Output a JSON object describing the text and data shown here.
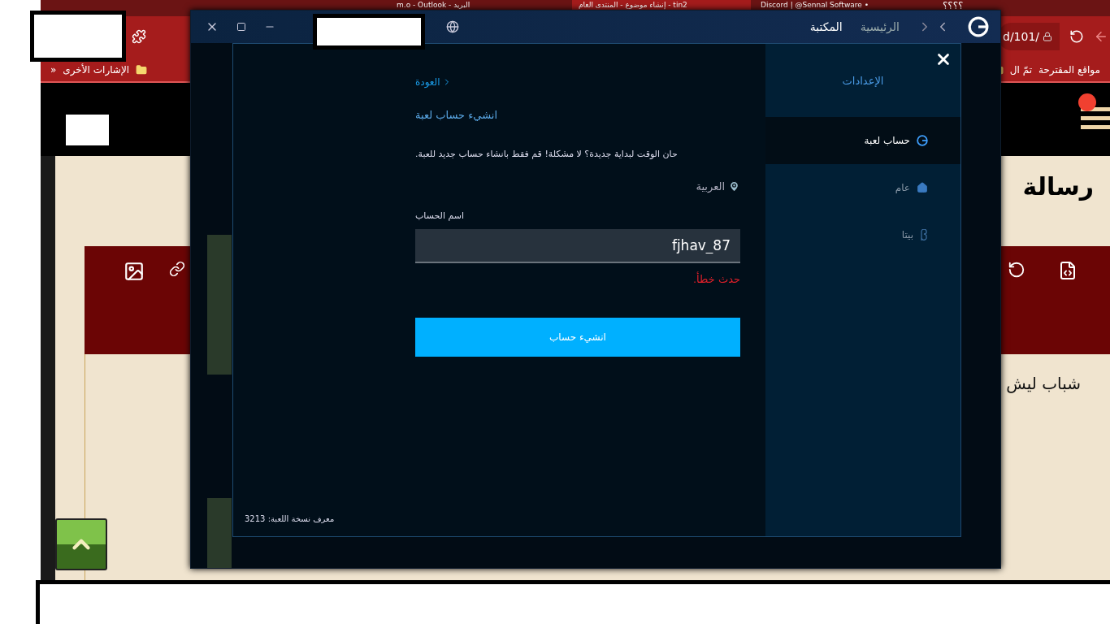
{
  "browser": {
    "tabs": [
      {
        "title": "Discord | @Sennal Software •",
        "selected": false
      },
      {
        "title": "إنشاء موضوع - المنتدى العام - tin2",
        "selected": true
      },
      {
        "title": "m.o - Outlook - البريد",
        "selected": false
      }
    ],
    "window_title": "؟؟؟؟",
    "address": "d/101/",
    "bookmarks_left": [
      "الإشارات الأخرى",
      "»"
    ],
    "bookmarks_right": [
      "مواقع المقترحة",
      "تمّ ال"
    ],
    "page": {
      "heading": "رسالة",
      "editor_text": "شباب ليش"
    }
  },
  "app": {
    "nav": [
      {
        "label": "الرئيسية",
        "selected": false
      },
      {
        "label": "المكتبة",
        "selected": true
      }
    ],
    "dialog": {
      "sidebar_title": "الإعدادات",
      "items": [
        {
          "label": "حساب لعبة",
          "selected": true
        },
        {
          "label": "عام",
          "selected": false
        },
        {
          "label": "بيتا",
          "selected": false
        }
      ],
      "back": "العودة",
      "title": "انشيء حساب لعبة",
      "description": "حان الوقت لبداية جديدة؟ لا مشكلة! قم فقط بانشاء حساب جديد للعبة.",
      "region": "العربية",
      "field_label": "اسم الحساب",
      "field_value": "fjhav_87",
      "error": "حدث خطأ.",
      "button": "انشيء حساب",
      "footer": "معرف نسخة اللعبة: 3213"
    }
  }
}
